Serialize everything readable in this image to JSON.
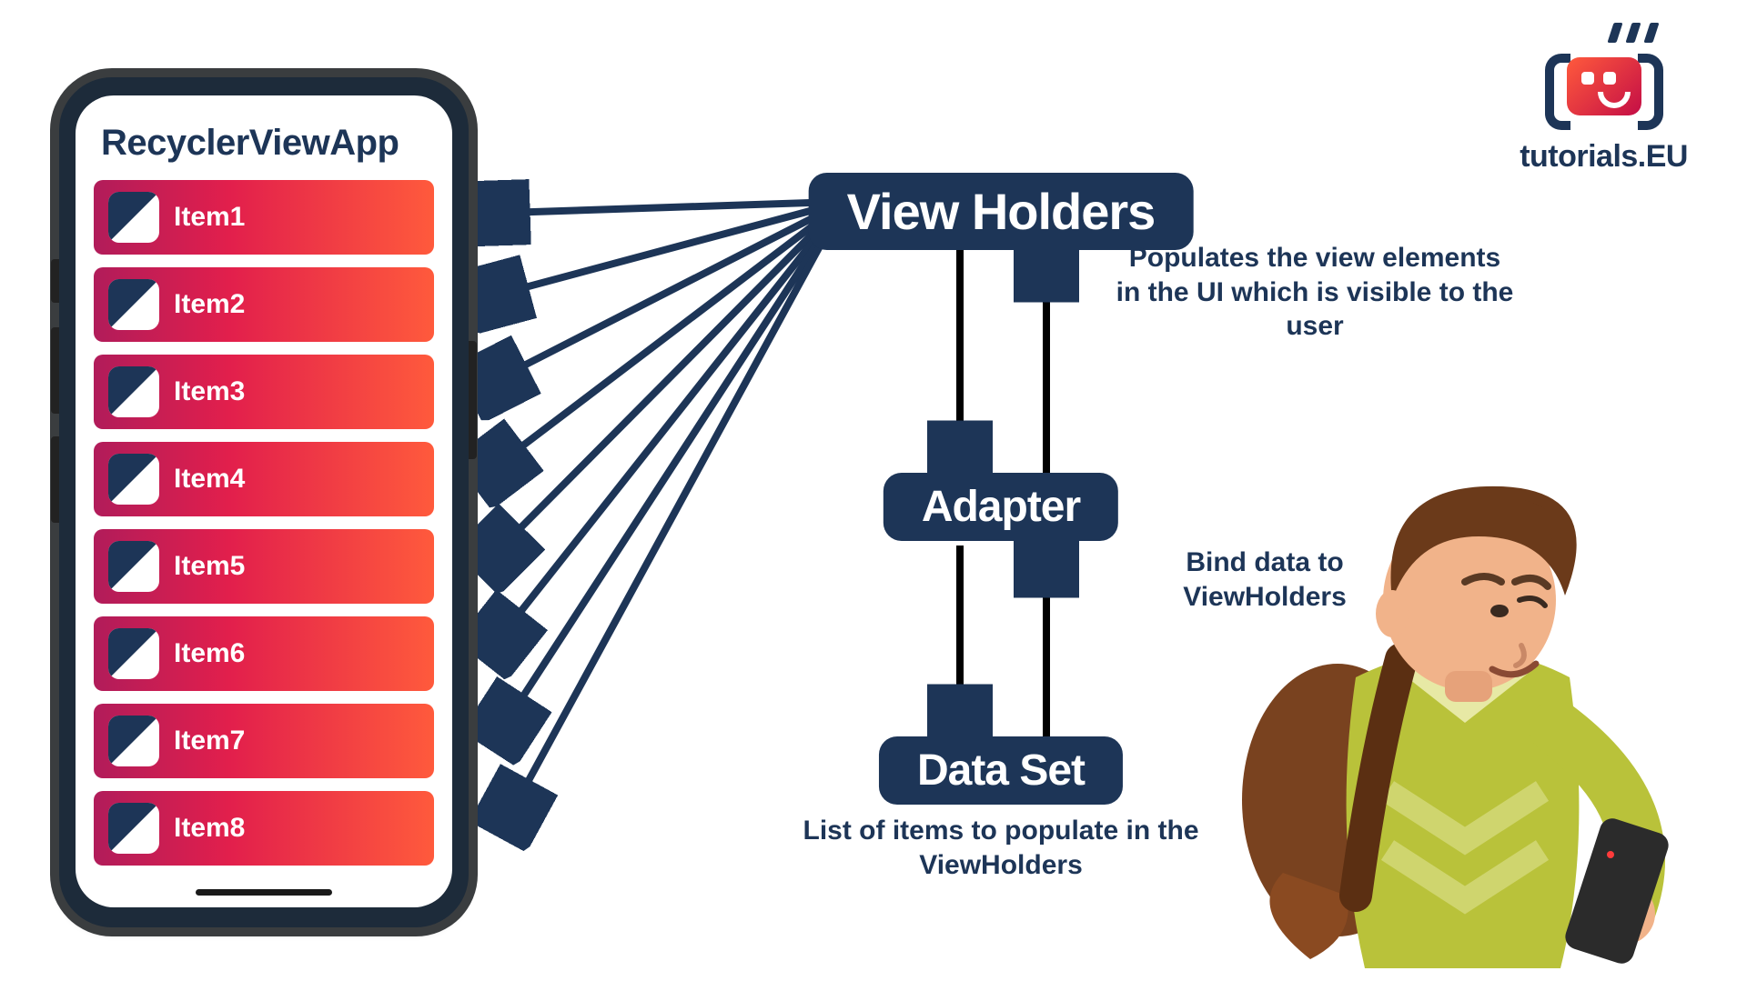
{
  "phone": {
    "title": "RecyclerViewApp",
    "items": [
      {
        "label": "Item1"
      },
      {
        "label": "Item2"
      },
      {
        "label": "Item3"
      },
      {
        "label": "Item4"
      },
      {
        "label": "Item5"
      },
      {
        "label": "Item6"
      },
      {
        "label": "Item7"
      },
      {
        "label": "Item8"
      }
    ]
  },
  "flow": {
    "view_holders": {
      "label": "View Holders",
      "caption": "Populates the view elements in the UI which is visible to the user"
    },
    "adapter": {
      "label": "Adapter",
      "caption": "Bind data to ViewHolders"
    },
    "data_set": {
      "label": "Data Set",
      "caption": "List of items to populate in the ViewHolders"
    }
  },
  "brand": {
    "name": "tutorials.EU"
  },
  "colors": {
    "navy": "#1d3557",
    "gradient_from": "#b11c5a",
    "gradient_to": "#ff5a3c"
  }
}
